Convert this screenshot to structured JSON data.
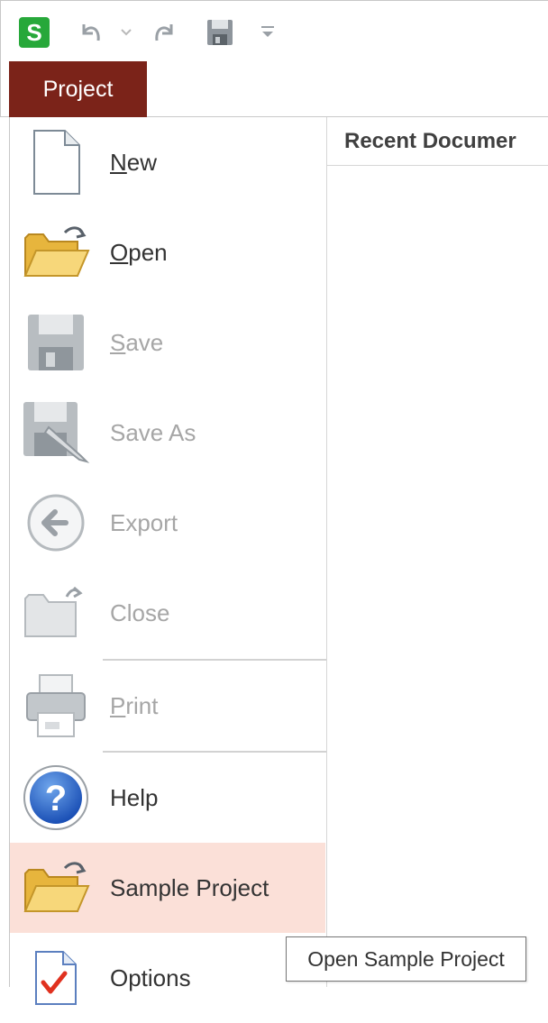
{
  "app": {
    "logo_letter": "S"
  },
  "quick_access": {
    "undo": "undo-icon",
    "redo": "redo-icon",
    "save": "save-icon",
    "customize": "dropdown-icon"
  },
  "tabs": {
    "project": "Project"
  },
  "menu": {
    "new": {
      "label_u": "N",
      "label_rest": "ew"
    },
    "open": {
      "label_u": "O",
      "label_rest": "pen"
    },
    "save": {
      "label_u": "S",
      "label_rest": "ave"
    },
    "save_as": {
      "label": "Save As"
    },
    "export": {
      "label": "Export"
    },
    "close": {
      "label": "Close"
    },
    "print": {
      "label_u": "P",
      "label_rest": "rint"
    },
    "help": {
      "label": "Help"
    },
    "sample_project": {
      "label": "Sample Project"
    },
    "options": {
      "label": "Options"
    }
  },
  "recent": {
    "header": "Recent Documer"
  },
  "tooltip": {
    "text": "Open Sample Project"
  },
  "colors": {
    "tab_bg": "#7b2319",
    "hover_bg": "#fbe0d8",
    "logo_green": "#27a83a",
    "disabled_text": "#a6a6a6"
  }
}
